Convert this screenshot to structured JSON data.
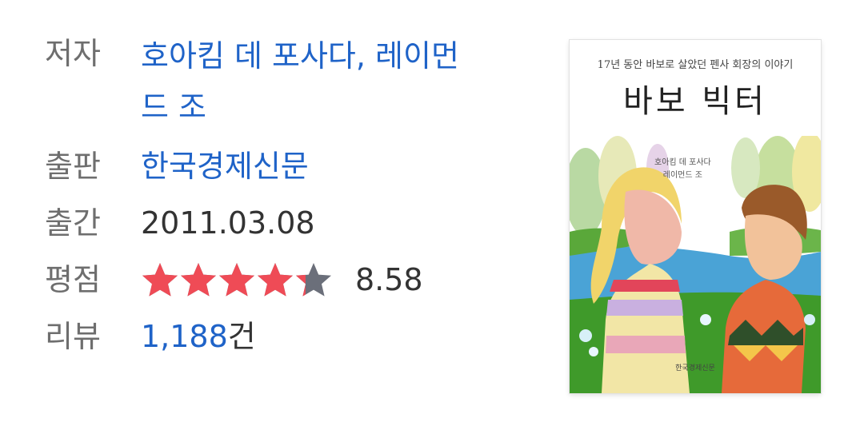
{
  "book": {
    "author": {
      "label": "저자",
      "line1": "호아킴 데 포사다, 레이먼",
      "line2": "드 조"
    },
    "publisher": {
      "label": "출판",
      "value": "한국경제신문"
    },
    "published_date": {
      "label": "출간",
      "value": "2011.03.08"
    },
    "rating": {
      "label": "평점",
      "score": "8.58",
      "stars_filled": 4.29,
      "stars_total": 5,
      "star_color": "#ef4b56",
      "star_empty_color": "#6b6f7a"
    },
    "reviews": {
      "label": "리뷰",
      "count": "1,188",
      "suffix": "건"
    }
  },
  "cover": {
    "subtitle": "17년 동안 바보로 살았던 펜사 회장의 이야기",
    "title": "바보 빅터",
    "authors_line1": "호아킴 데 포사다",
    "authors_line2": "레이먼드 조",
    "publisher": "한국경제신문"
  },
  "colors": {
    "link": "#1f63c8",
    "label": "#6e6e6e",
    "text": "#333333"
  }
}
